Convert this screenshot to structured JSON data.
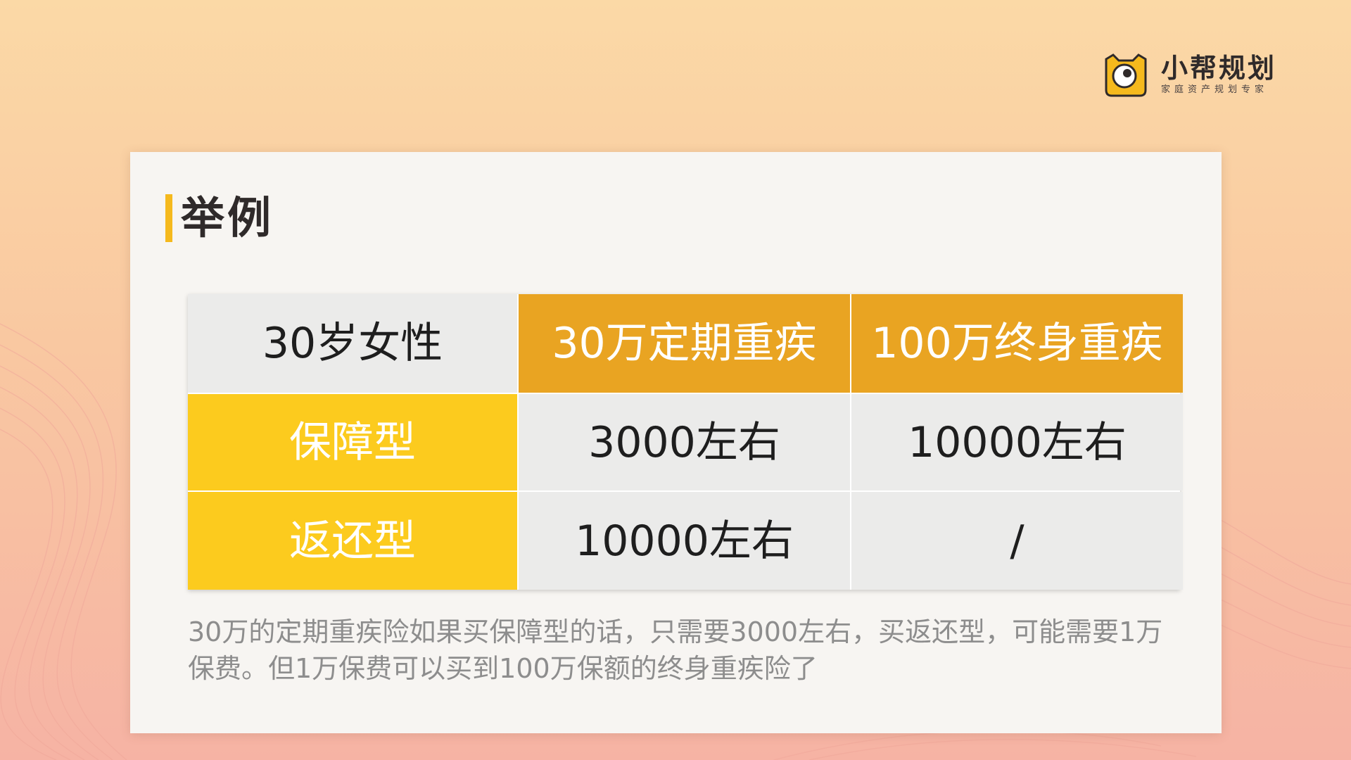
{
  "logo": {
    "name": "小帮规划",
    "tagline": "家庭资产规划专家",
    "brand_color": "#f5b91d"
  },
  "card": {
    "title": "举例"
  },
  "table": {
    "header": [
      "30岁女性",
      "30万定期重疾",
      "100万终身重疾"
    ],
    "rows": [
      [
        "保障型",
        "3000左右",
        "10000左右"
      ],
      [
        "返还型",
        "10000左右",
        "/"
      ]
    ]
  },
  "note": "30万的定期重疾险如果买保障型的话，只需要3000左右，买返还型，可能需要1万保费。但1万保费可以买到100万保额的终身重疾险了",
  "colors": {
    "header_orange": "#e9a422",
    "row_yellow": "#fccb1e",
    "cell_gray": "#ebebea"
  }
}
